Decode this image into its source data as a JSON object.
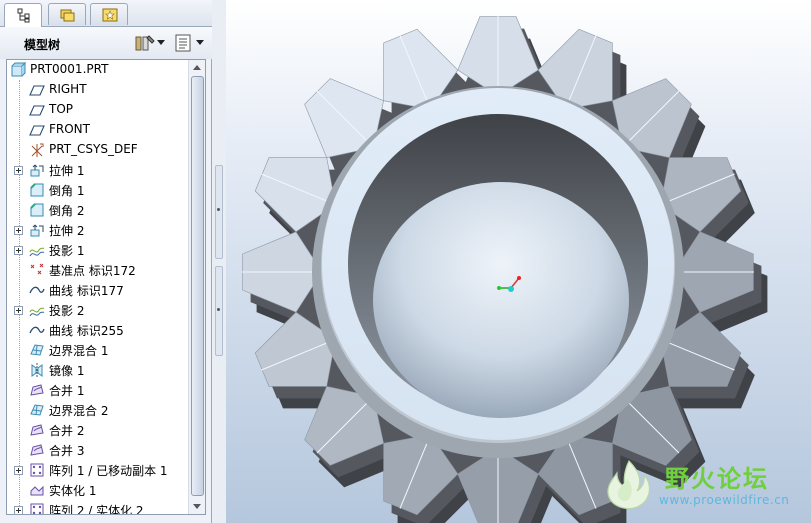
{
  "tabs": [
    {
      "name": "model-tree",
      "icon": "tree-icon",
      "active": true
    },
    {
      "name": "folders",
      "icon": "folders-icon",
      "active": false
    },
    {
      "name": "favorites",
      "icon": "favorites-icon",
      "active": false
    }
  ],
  "tree_header": {
    "title": "模型树",
    "settings_icon": "tree-settings-icon",
    "show_icon": "tree-show-icon"
  },
  "tree": {
    "root": {
      "label": "PRT0001.PRT",
      "icon": "part-icon"
    },
    "items": [
      {
        "label": "RIGHT",
        "icon": "datum-plane-icon",
        "expandable": false
      },
      {
        "label": "TOP",
        "icon": "datum-plane-icon",
        "expandable": false
      },
      {
        "label": "FRONT",
        "icon": "datum-plane-icon",
        "expandable": false
      },
      {
        "label": "PRT_CSYS_DEF",
        "icon": "csys-icon",
        "expandable": false
      },
      {
        "label": "拉伸 1",
        "icon": "extrude-icon",
        "expandable": true
      },
      {
        "label": "倒角 1",
        "icon": "chamfer-icon",
        "expandable": false
      },
      {
        "label": "倒角 2",
        "icon": "chamfer-icon",
        "expandable": false
      },
      {
        "label": "拉伸 2",
        "icon": "extrude-icon",
        "expandable": true
      },
      {
        "label": "投影 1",
        "icon": "projection-icon",
        "expandable": true
      },
      {
        "label": "基准点 标识172",
        "icon": "datum-point-icon",
        "expandable": false
      },
      {
        "label": "曲线 标识177",
        "icon": "curve-icon",
        "expandable": false
      },
      {
        "label": "投影 2",
        "icon": "projection-icon",
        "expandable": true
      },
      {
        "label": "曲线 标识255",
        "icon": "curve-icon",
        "expandable": false
      },
      {
        "label": "边界混合 1",
        "icon": "boundary-blend-icon",
        "expandable": false
      },
      {
        "label": "镜像 1",
        "icon": "mirror-icon",
        "expandable": false
      },
      {
        "label": "合并 1",
        "icon": "merge-icon",
        "expandable": false
      },
      {
        "label": "边界混合 2",
        "icon": "boundary-blend-icon",
        "expandable": false
      },
      {
        "label": "合并 2",
        "icon": "merge-icon",
        "expandable": false
      },
      {
        "label": "合并 3",
        "icon": "merge-icon",
        "expandable": false
      },
      {
        "label": "阵列 1 / 已移动副本 1",
        "icon": "pattern-icon",
        "expandable": true
      },
      {
        "label": "实体化 1",
        "icon": "solidify-icon",
        "expandable": false
      },
      {
        "label": "阵列 2 / 实体化 2",
        "icon": "pattern-icon",
        "expandable": true
      }
    ]
  },
  "model": {
    "description_icon": "gear-model-icon",
    "teeth": 16,
    "csys_icon": "csys-triad-icon"
  },
  "watermark": {
    "title": "野火论坛",
    "url": "www.proewildfire.cn"
  },
  "colors": {
    "tree_bg": "#ffffff",
    "panel_bg": "#eef2f8",
    "gear_light": "#dde8f4",
    "gear_dark": "#4b4e53",
    "wm_green": "#6fcf3c",
    "wm_blue": "#5cb8e0"
  }
}
